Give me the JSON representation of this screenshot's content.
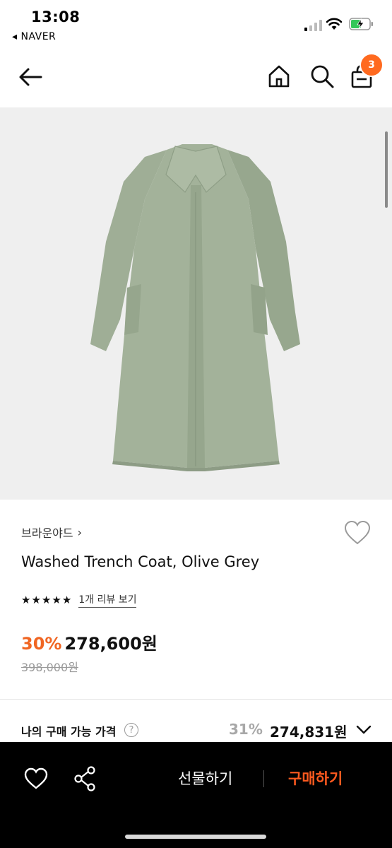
{
  "status_bar": {
    "time": "13:08",
    "back_app": "◂ NAVER"
  },
  "nav": {
    "cart_count": "3",
    "icons": [
      "back-arrow-icon",
      "home-icon",
      "search-icon",
      "cart-icon"
    ]
  },
  "product": {
    "brand": "브라운야드",
    "title": "Washed Trench Coat, Olive Grey",
    "rating_stars": 5,
    "review_link": "1개 리뷰 보기",
    "discount": "30%",
    "price": "278,600원",
    "original_price": "398,000원",
    "image_color": "#a3b29a"
  },
  "my_price": {
    "label": "나의 구매 가능 가격",
    "help": "?",
    "discount": "31%",
    "amount": "274,831원"
  },
  "bottom_bar": {
    "gift_label": "선물하기",
    "buy_label": "구매하기",
    "buy_color": "#ff5a1f"
  },
  "colors": {
    "accent": "#f06522",
    "badge": "#ff6a1f"
  }
}
